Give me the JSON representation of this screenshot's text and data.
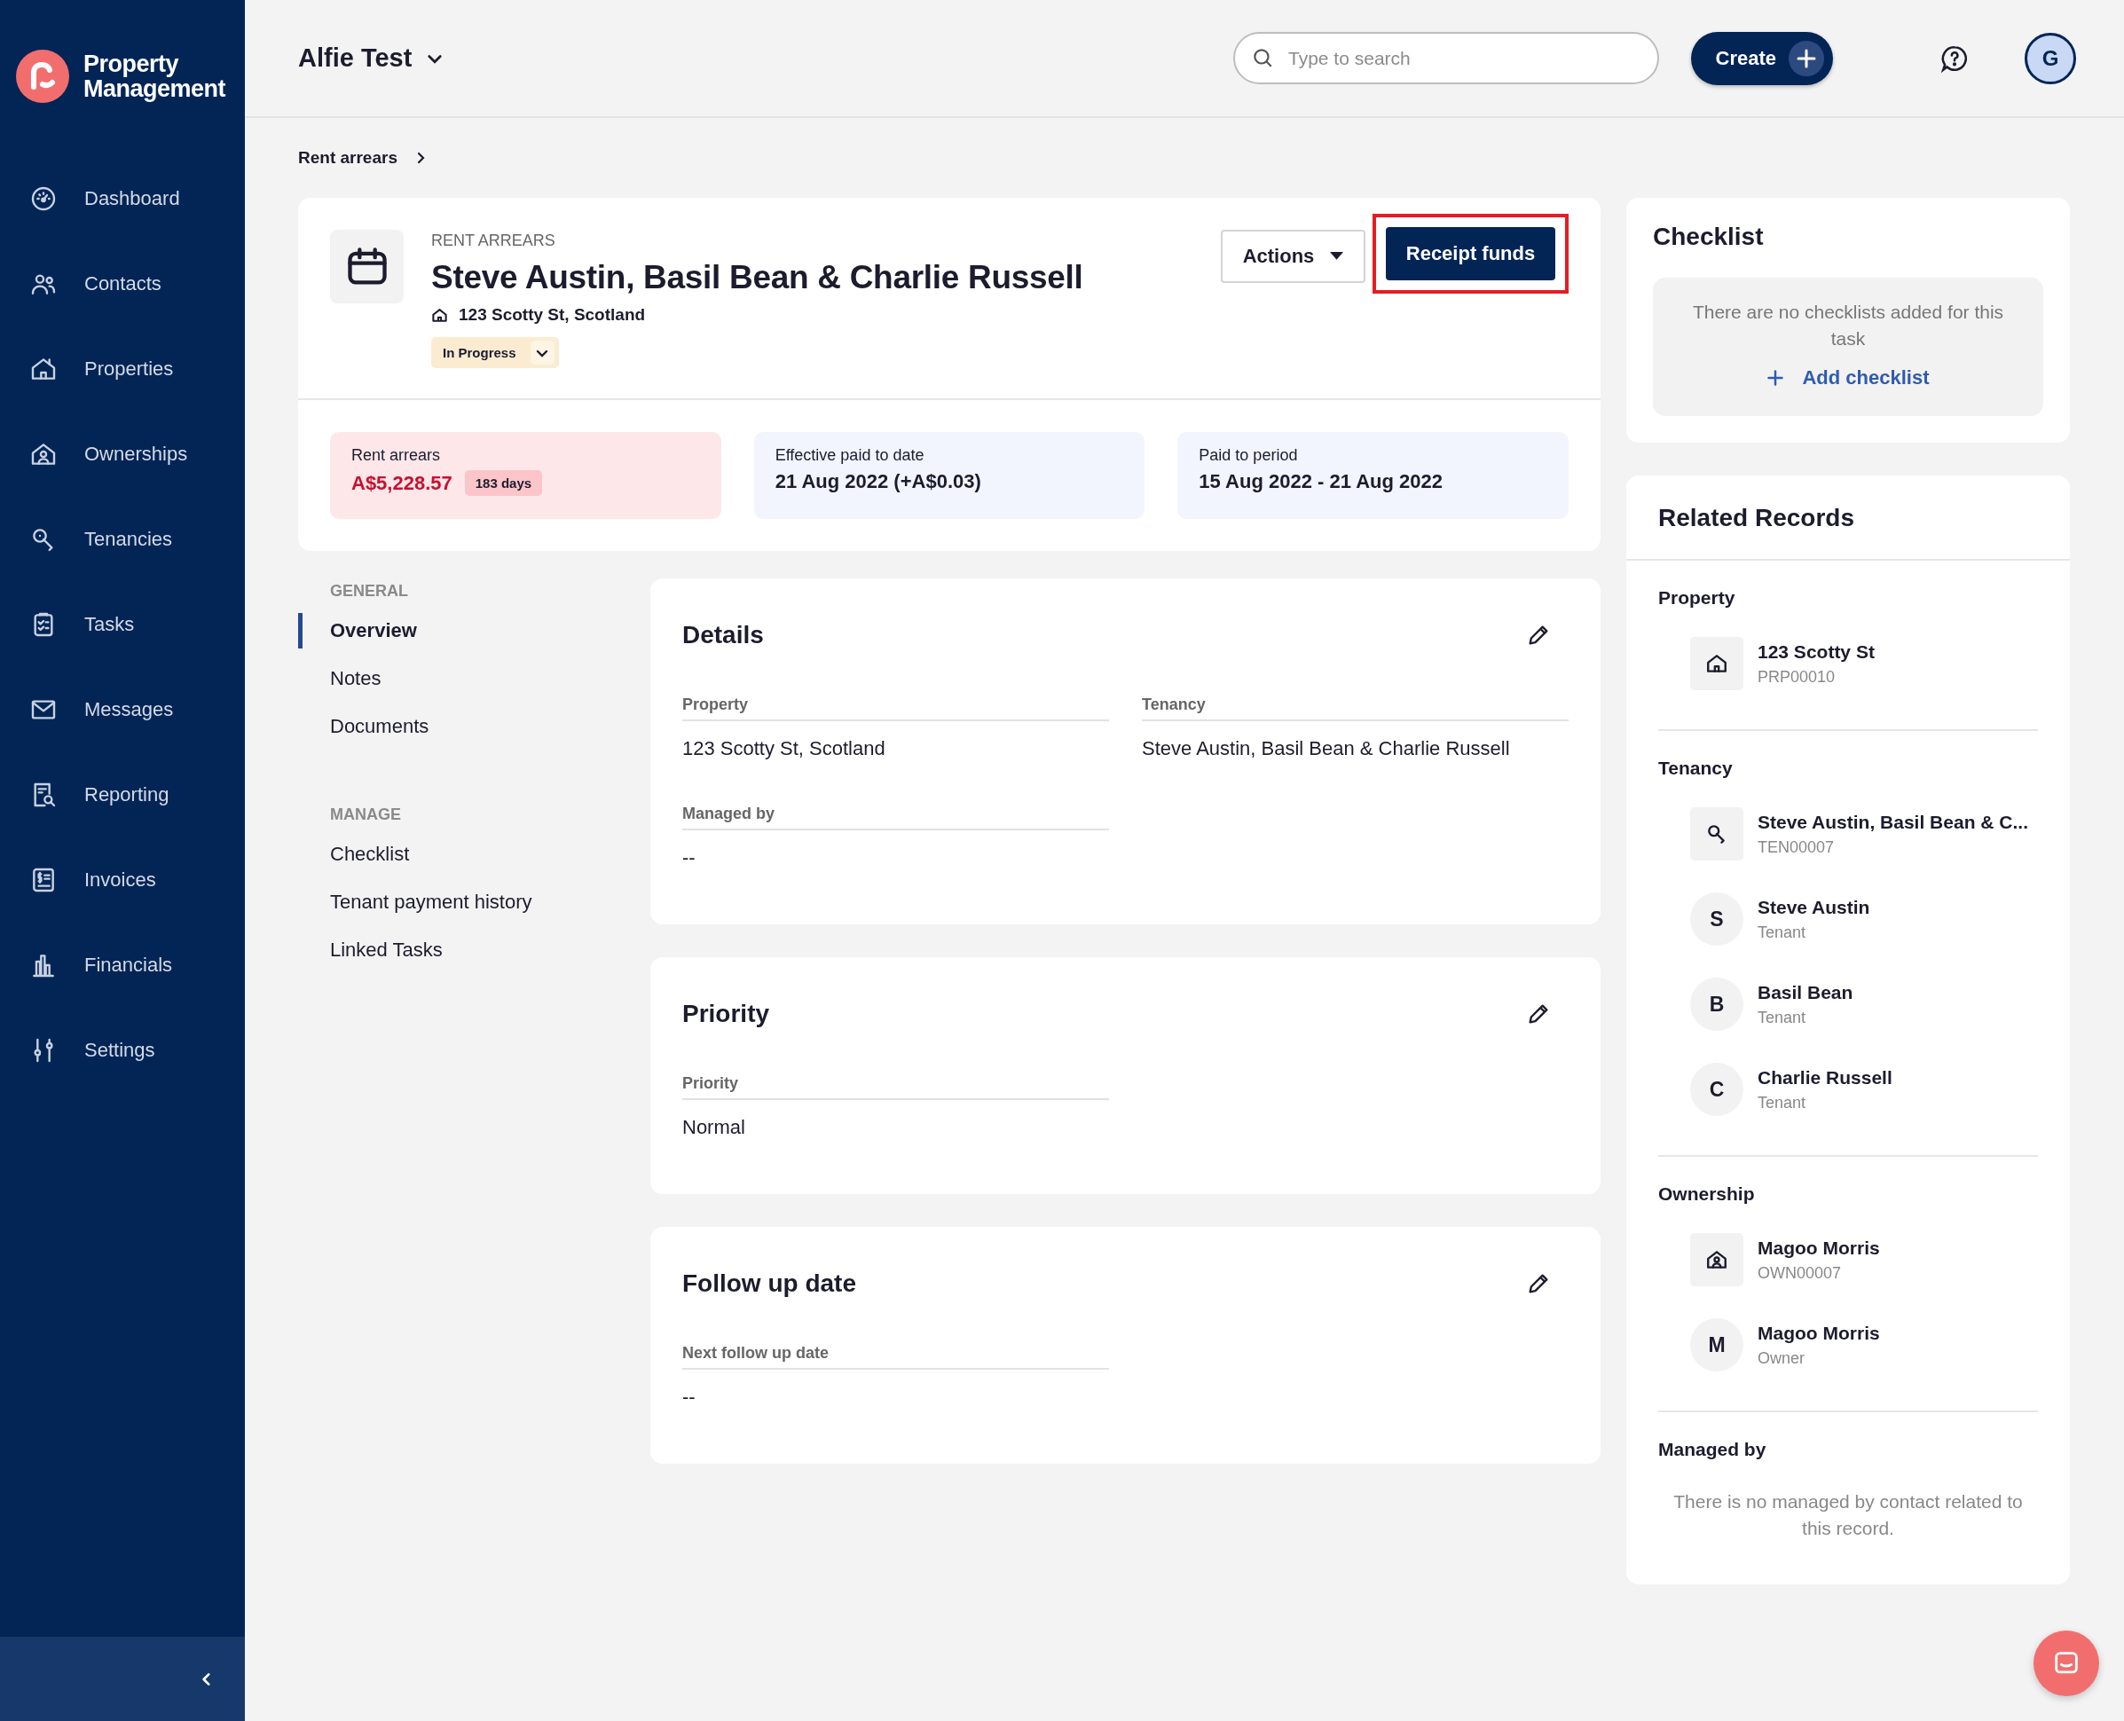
{
  "app": {
    "name_line1": "Property",
    "name_line2": "Management"
  },
  "sidebar": {
    "items": [
      {
        "label": "Dashboard",
        "kind": "dashboard",
        "selected": false
      },
      {
        "label": "Contacts",
        "kind": "contacts",
        "selected": false
      },
      {
        "label": "Properties",
        "kind": "properties",
        "selected": false
      },
      {
        "label": "Ownerships",
        "kind": "ownerships",
        "selected": false
      },
      {
        "label": "Tenancies",
        "kind": "tenancies",
        "selected": false
      },
      {
        "label": "Tasks",
        "kind": "tasks",
        "selected": false
      },
      {
        "label": "Messages",
        "kind": "messages",
        "selected": false
      },
      {
        "label": "Reporting",
        "kind": "reporting",
        "selected": false
      },
      {
        "label": "Invoices",
        "kind": "invoices",
        "selected": false
      },
      {
        "label": "Financials",
        "kind": "financials",
        "selected": false
      },
      {
        "label": "Settings",
        "kind": "settings",
        "selected": false
      }
    ]
  },
  "header": {
    "workspace": "Alfie Test",
    "search": {
      "placeholder": "Type to search"
    },
    "create_button": "Create",
    "avatar": "G"
  },
  "breadcrumb": [
    "Rent arrears"
  ],
  "task": {
    "type_label": "RENT ARREARS",
    "title": "Steve Austin, Basil Bean & Charlie Russell",
    "address": "123 Scotty St, Scotland",
    "status": "In Progress",
    "actions_button": "Actions",
    "primary_button": {
      "label": "Receipt funds",
      "highlighted": true
    }
  },
  "stats": [
    {
      "kind": "alert",
      "label": "Rent arrears",
      "value": "A$5,228.57",
      "badge": "183 days"
    },
    {
      "kind": "info",
      "label": "Effective paid to date",
      "value": "21 Aug 2022 (+A$0.03)"
    },
    {
      "kind": "info",
      "label": "Paid to period",
      "value": "15 Aug 2022 - 21 Aug 2022"
    }
  ],
  "section_nav": [
    {
      "heading": "GENERAL",
      "items": [
        {
          "label": "Overview",
          "selected": true
        },
        {
          "label": "Notes",
          "selected": false
        },
        {
          "label": "Documents",
          "selected": false
        }
      ]
    },
    {
      "heading": "MANAGE",
      "items": [
        {
          "label": "Checklist",
          "selected": false
        },
        {
          "label": "Tenant payment history",
          "selected": false
        },
        {
          "label": "Linked Tasks",
          "selected": false
        }
      ]
    }
  ],
  "cards": [
    {
      "title": "Details",
      "fields": [
        {
          "label": "Property",
          "value": "123 Scotty St, Scotland"
        },
        {
          "label": "Tenancy",
          "value": "Steve Austin, Basil Bean & Charlie Russell"
        },
        {
          "label": "Managed by",
          "value": "--"
        }
      ]
    },
    {
      "title": "Priority",
      "fields": [
        {
          "label": "Priority",
          "value": "Normal"
        }
      ]
    },
    {
      "title": "Follow up date",
      "fields": [
        {
          "label": "Next follow up date",
          "value": "--"
        }
      ]
    }
  ],
  "checklist": {
    "title": "Checklist",
    "empty_text": "There are no checklists added for this task",
    "add_link": "Add checklist"
  },
  "related_records": {
    "title": "Related Records",
    "groups": [
      {
        "heading": "Property",
        "items": [
          {
            "kind": "property",
            "name": "123 Scotty St",
            "sub": "PRP00010"
          }
        ]
      },
      {
        "heading": "Tenancy",
        "items": [
          {
            "kind": "tenancy",
            "name": "Steve Austin, Basil Bean & C...",
            "sub": "TEN00007"
          },
          {
            "kind": "person",
            "initial": "S",
            "name": "Steve Austin",
            "sub": "Tenant"
          },
          {
            "kind": "person",
            "initial": "B",
            "name": "Basil Bean",
            "sub": "Tenant"
          },
          {
            "kind": "person",
            "initial": "C",
            "name": "Charlie Russell",
            "sub": "Tenant"
          }
        ]
      },
      {
        "heading": "Ownership",
        "items": [
          {
            "kind": "ownership",
            "name": "Magoo Morris",
            "sub": "OWN00007"
          },
          {
            "kind": "person",
            "initial": "M",
            "name": "Magoo Morris",
            "sub": "Owner"
          }
        ]
      },
      {
        "heading": "Managed by",
        "empty_text": "There is no managed by contact related to this record."
      }
    ]
  }
}
